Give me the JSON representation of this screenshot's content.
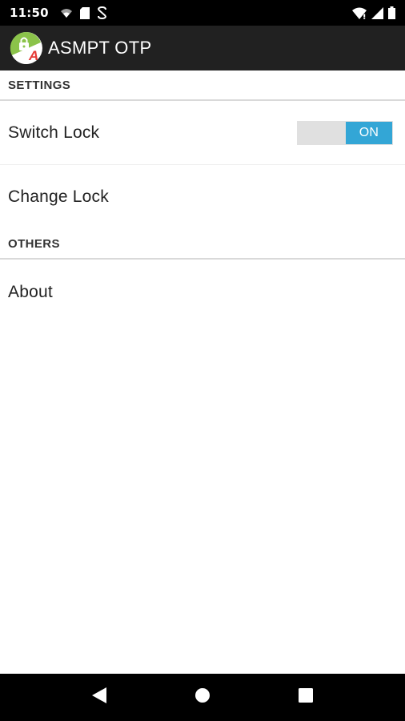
{
  "status_bar": {
    "time": "11:50"
  },
  "app_bar": {
    "title": "ASMPT OTP",
    "logo_letter": "A"
  },
  "sections": {
    "settings": {
      "header": "SETTINGS",
      "switch_lock": {
        "label": "Switch Lock",
        "toggle_state": "ON"
      },
      "change_lock": {
        "label": "Change Lock"
      }
    },
    "others": {
      "header": "OTHERS",
      "about": {
        "label": "About"
      }
    }
  },
  "colors": {
    "toggle_on": "#33a6d6",
    "app_bar": "#212121",
    "logo_green": "#8bc34a",
    "logo_red": "#e53935"
  },
  "icons": {
    "status_left": [
      "wifi-calling-icon",
      "sd-card-icon",
      "sync-icon"
    ],
    "status_right": [
      "wifi-signal-icon",
      "cell-signal-icon",
      "battery-icon"
    ],
    "nav": [
      "back-icon",
      "home-icon",
      "recents-icon"
    ]
  }
}
